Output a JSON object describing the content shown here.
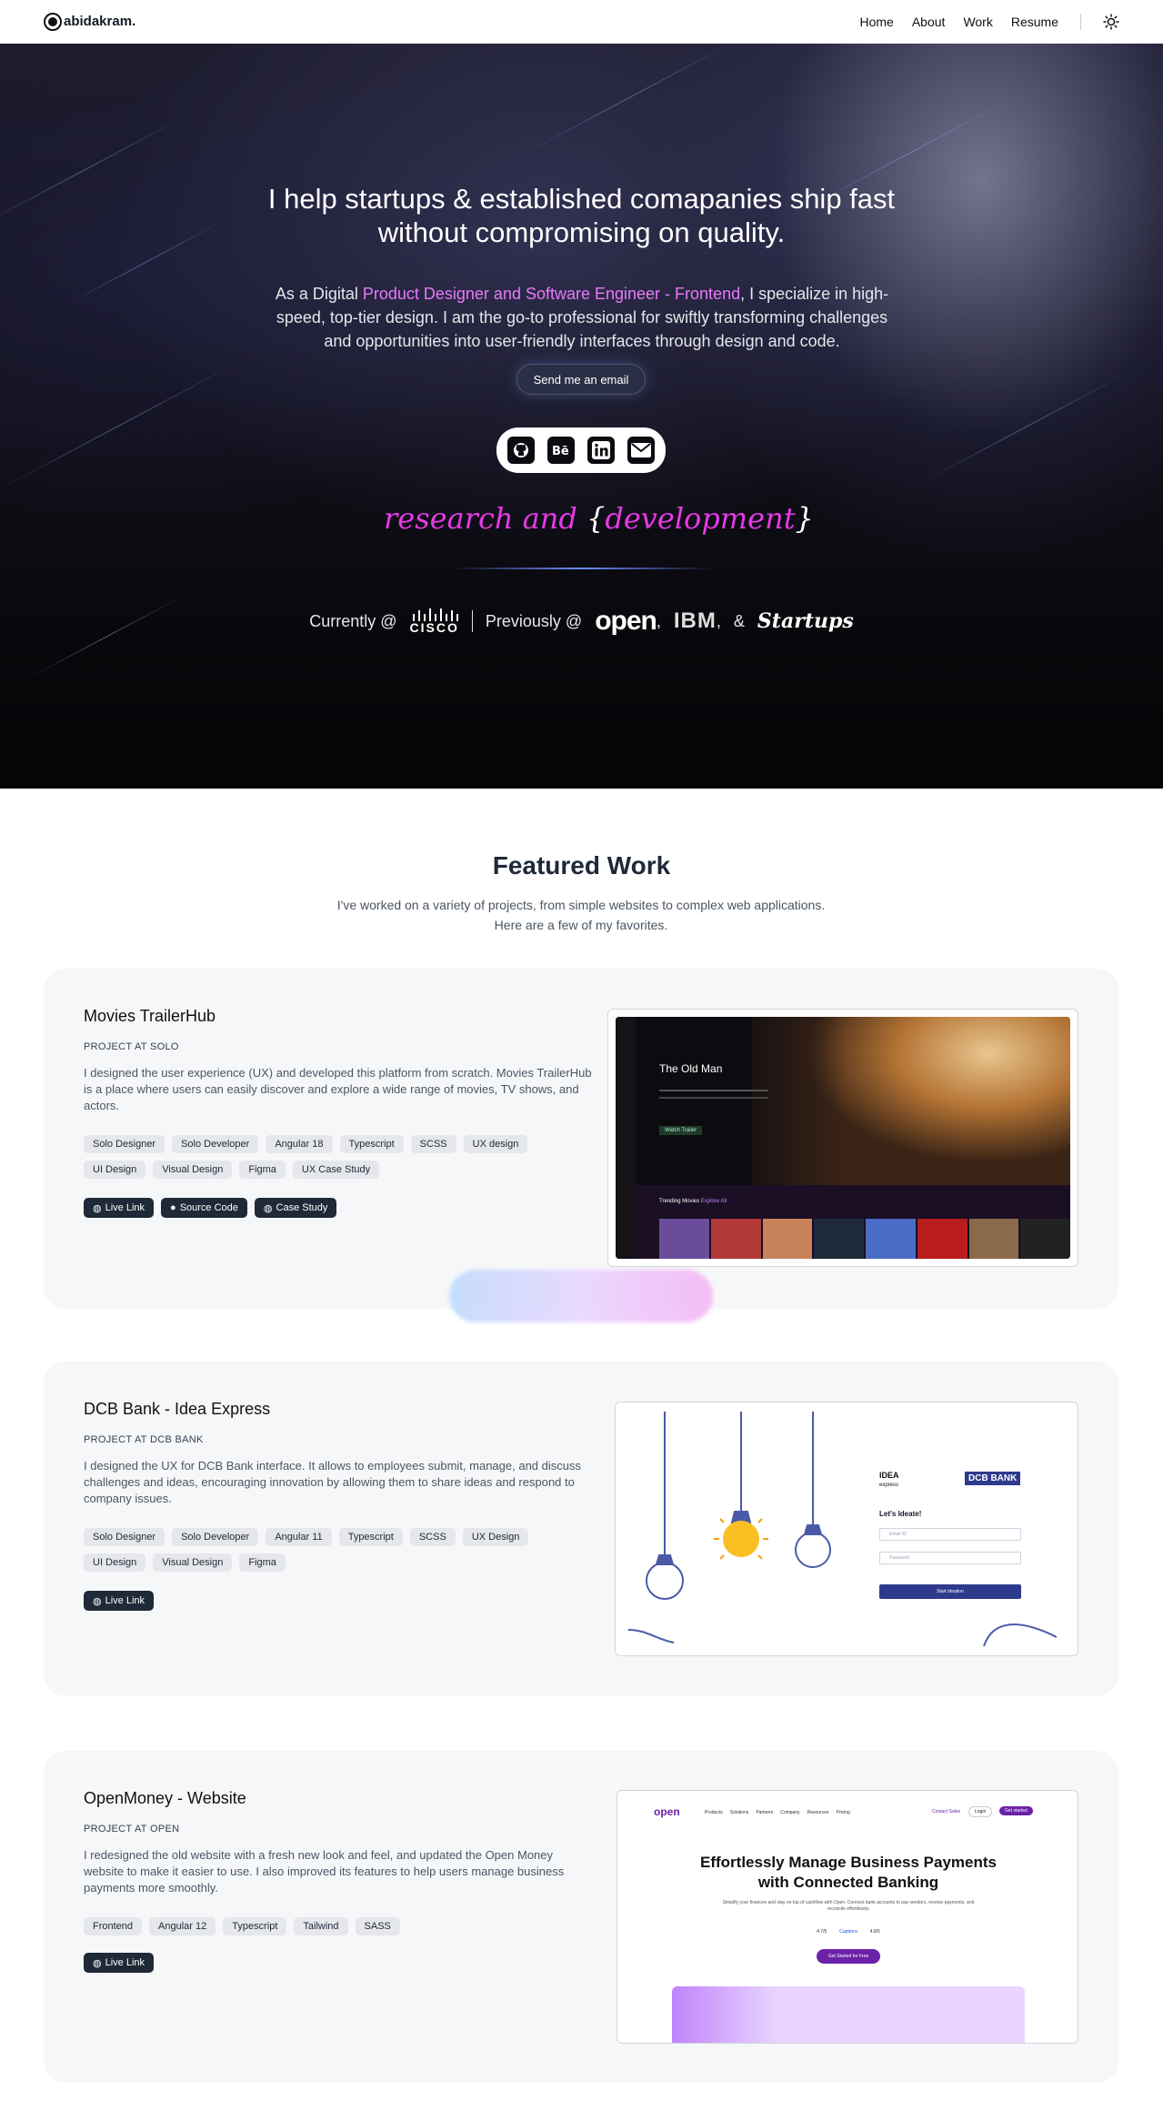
{
  "nav": {
    "logo_text": "abidakram.",
    "links": [
      "Home",
      "About",
      "Work",
      "Resume"
    ],
    "theme_icon": "sun-icon"
  },
  "hero": {
    "headline_line1": "I help startups & established comapanies ship fast",
    "headline_line2": "without compromising on quality.",
    "lead_prefix": "As a Digital ",
    "lead_highlight": "Product Designer and Software Engineer - Frontend",
    "lead_suffix": ", I specialize in high-speed, top-tier design. I am the go-to professional for swiftly transforming challenges and opportunities into user-friendly interfaces through design and code.",
    "cta_label": "Send me an email",
    "socials": [
      "github-icon",
      "behance-icon",
      "linkedin-icon",
      "mail-icon"
    ],
    "rd_plain": "research and ",
    "rd_brace_open": "{",
    "rd_word": "development",
    "rd_brace_close": "}",
    "currently_label": "Currently @",
    "current_company": "CISCO",
    "previously_label": "Previously @",
    "prev_companies": [
      "open",
      "IBM",
      "Startups"
    ],
    "comma": ",",
    "amp": "&"
  },
  "featured": {
    "title": "Featured Work",
    "subtitle_line1": "I've worked on a variety of projects, from simple websites to complex web applications.",
    "subtitle_line2": "Here are a few of my favorites."
  },
  "projects": [
    {
      "title": "Movies TrailerHub",
      "subtitle": "PROJECT AT SOLO",
      "description": "I designed the user experience (UX) and developed this platform from scratch. Movies TrailerHub is a place where users can easily discover and explore a wide range of movies, TV shows, and actors.",
      "tags": [
        "Solo Designer",
        "Solo Developer",
        "Angular 18",
        "Typescript",
        "SCSS",
        "UX design",
        "UI Design",
        "Visual Design",
        "Figma",
        "UX Case Study"
      ],
      "buttons": [
        "Live Link",
        "Source Code",
        "Case Study"
      ],
      "preview": {
        "movie_title": "The Old Man",
        "cta": "Watch Trailer",
        "section": "Trending Movies",
        "section_tag": "Explore All"
      }
    },
    {
      "title": "DCB Bank - Idea Express",
      "subtitle": "PROJECT AT DCB BANK",
      "description": "I designed the UX for DCB Bank interface. It allows to employees submit, manage, and discuss challenges and ideas, encouraging innovation by allowing them to share ideas and respond to company issues.",
      "tags": [
        "Solo Designer",
        "Solo Developer",
        "Angular 11",
        "Typescript",
        "SCSS",
        "UX Design",
        "UI Design",
        "Visual Design",
        "Figma"
      ],
      "buttons": [
        "Live Link"
      ],
      "preview": {
        "brand_left": "IDEA",
        "brand_left_sub": "express",
        "brand_right": "DCB BANK",
        "heading": "Let's Ideate!",
        "email_ph": "Email ID",
        "password_ph": "Password",
        "cta": "Start Ideation"
      }
    },
    {
      "title": "OpenMoney - Website",
      "subtitle": "PROJECT AT OPEN",
      "description": "I redesigned the old website with a fresh new look and feel, and updated the Open Money website to make it easier to use. I also improved its features to help users manage business payments more smoothly.",
      "tags": [
        "Frontend",
        "Angular 12",
        "Typescript",
        "Tailwind",
        "SASS"
      ],
      "buttons": [
        "Live Link"
      ],
      "preview": {
        "logo": "open",
        "menu": [
          "Products",
          "Solutions",
          "Partners",
          "Company",
          "Resources",
          "Pricing"
        ],
        "contact": "Contact Sales",
        "login": "Login",
        "started": "Get started",
        "hero_line1": "Effortlessly Manage Business Payments",
        "hero_line2": "with Connected Banking",
        "hero_sub": "Simplify your finances and stay on top of cashflow with Open. Connect bank accounts to pay vendors, receive payments, and reconcile effortlessly.",
        "ratings": [
          "4.7/5",
          "Capterra",
          "4.8/5"
        ],
        "cta": "Get Started for Free"
      }
    }
  ]
}
